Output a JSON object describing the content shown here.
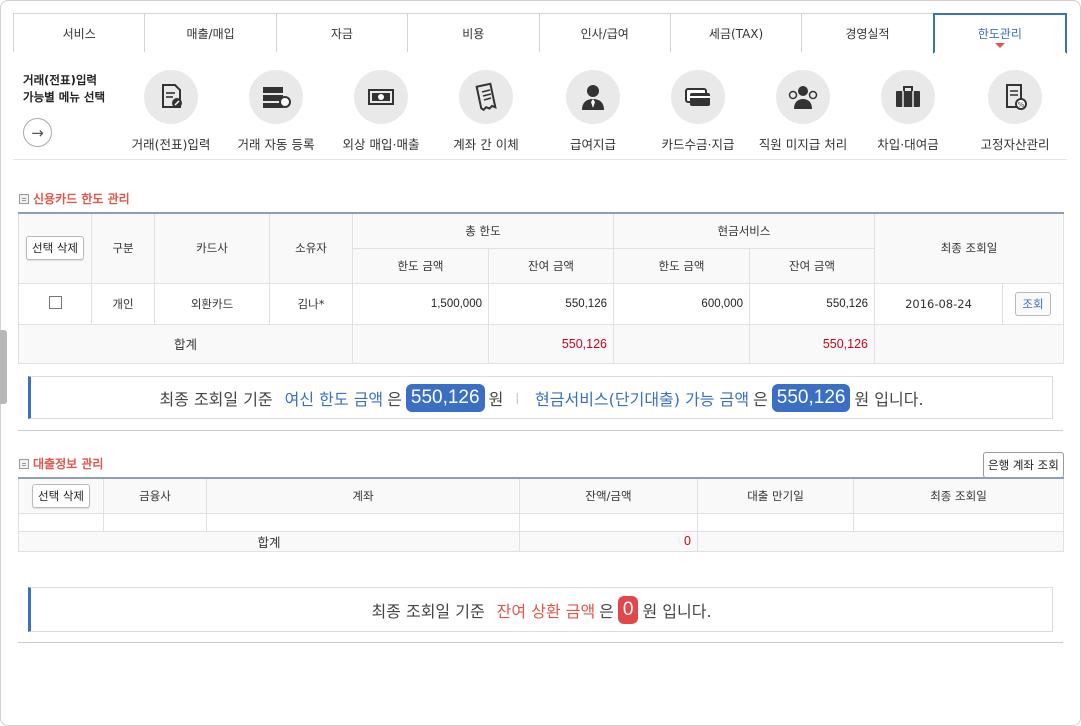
{
  "tabs": [
    "서비스",
    "매출/매입",
    "자금",
    "비용",
    "인사/급여",
    "세금(TAX)",
    "경영실적",
    "한도관리"
  ],
  "active_tab": "한도관리",
  "menu": {
    "guide_line1": "거래(전표)입력",
    "guide_line2": "가능별 메뉴 선택",
    "items": [
      {
        "label": "거래(전표)입력",
        "icon": "document-pen-icon"
      },
      {
        "label": "거래 자동 등록",
        "icon": "server-icon"
      },
      {
        "label": "외상 매입·매출",
        "icon": "cash-icon"
      },
      {
        "label": "계좌 간 이체",
        "icon": "receipt-icon"
      },
      {
        "label": "급여지급",
        "icon": "person-icon"
      },
      {
        "label": "카드수금·지급",
        "icon": "credit-card-icon"
      },
      {
        "label": "직원 미지급 처리",
        "icon": "employee-icon"
      },
      {
        "label": "차입·대여금",
        "icon": "briefcase-icon"
      },
      {
        "label": "고정자산관리",
        "icon": "asset-document-icon"
      }
    ]
  },
  "credit_card": {
    "title": "신용카드 한도 관리",
    "headers": {
      "delete_btn": "선택 삭제",
      "type": "구분",
      "card_company": "카드사",
      "owner": "소유자",
      "total_limit": "총 한도",
      "cash_service": "현금서비스",
      "limit_amount": "한도 금액",
      "balance_amount": "잔여 금액",
      "last_query_date": "최종 조회일"
    },
    "rows": [
      {
        "type": "개인",
        "card_company": "외환카드",
        "owner": "김나*",
        "total_limit": "1,500,000",
        "total_balance": "550,126",
        "cash_limit": "600,000",
        "cash_balance": "550,126",
        "date": "2016-08-24",
        "query_btn": "조회"
      }
    ],
    "sum_label": "합계",
    "sum_total_balance": "550,126",
    "sum_cash_balance": "550,126"
  },
  "summary1": {
    "prefix": "최종 조회일 기준",
    "credit_label": "여신 한도 금액",
    "particle1": "은",
    "credit_value": "550,126",
    "unit1": "원",
    "separator": "|",
    "cash_label": "현금서비스(단기대출) 가능 금액",
    "particle2": "은",
    "cash_value": "550,126",
    "suffix": "원 입니다."
  },
  "loan": {
    "title": "대출정보 관리",
    "bank_btn": "은행 계좌 조회",
    "headers": {
      "delete_btn": "선택 삭제",
      "financial_company": "금융사",
      "account": "계좌",
      "balance": "잔액/금액",
      "maturity": "대출 만기일",
      "last_query_date": "최종 조회일"
    },
    "sum_label": "합계",
    "sum_value": "0"
  },
  "summary2": {
    "prefix": "최종 조회일 기준",
    "label": "잔여 상환 금액",
    "particle": "은",
    "value": "0",
    "suffix": "원 입니다."
  }
}
